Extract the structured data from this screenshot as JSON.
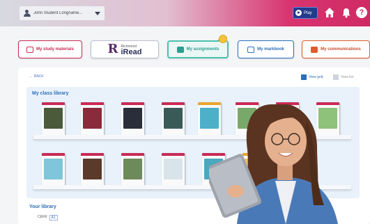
{
  "topbar": {
    "user_name": "John Student Longname...",
    "play_label": "Play"
  },
  "nav": {
    "study": "My study materials",
    "iread_brand_small": "Richmond",
    "iread_brand_big": "iRead",
    "iread_r": "R",
    "assignments": "My assignments",
    "markbook": "My markbook",
    "communications": "My communications"
  },
  "main": {
    "back_label": "BACK",
    "view_grid": "View grid",
    "view_list": "View list",
    "class_library_title": "My class library",
    "your_library_title": "Your library",
    "filters": [
      "CEFR",
      "A1"
    ]
  },
  "colors": {
    "brand_pink": "#cf2a64",
    "teal": "#4dc0b1",
    "blue": "#2c6fb8",
    "orange": "#e05a2b"
  },
  "books_row1": [
    {
      "band": "#c92a56",
      "art": "#4a5a3a"
    },
    {
      "band": "#c92a56",
      "art": "#8a2a3a"
    },
    {
      "band": "#c92a56",
      "art": "#2a2e3a"
    },
    {
      "band": "#c92a56",
      "art": "#3a5a58"
    },
    {
      "band": "#e8a530",
      "art": "#4cb0c9"
    },
    {
      "band": "#c92a56",
      "art": "#78a86a"
    },
    {
      "band": "#c92a56",
      "art": "#6a3a2a"
    },
    {
      "band": "#c92a56",
      "art": "#8ec27a"
    }
  ],
  "books_row2": [
    {
      "band": "#c92a56",
      "art": "#7ec6d9"
    },
    {
      "band": "#c92a56",
      "art": "#5a3a2a"
    },
    {
      "band": "#c92a56",
      "art": "#6c8a5a"
    },
    {
      "band": "#c92a56",
      "art": "#d9e3ea"
    },
    {
      "band": "#c92a56",
      "art": "#4aa8c0"
    },
    {
      "band": "#e8a530",
      "art": "#f0c060"
    }
  ]
}
